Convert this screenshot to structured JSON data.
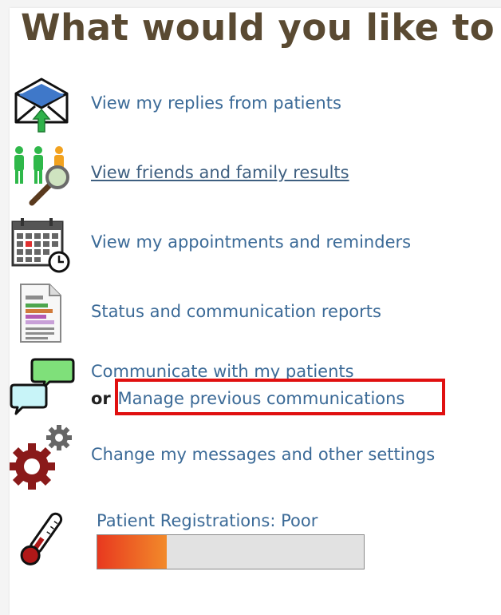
{
  "page": {
    "title": "What would you like to"
  },
  "menu": {
    "items": [
      {
        "label": "View my replies from patients",
        "icon": "envelope-reply-icon"
      },
      {
        "label": "View friends and family results",
        "icon": "people-magnifier-icon"
      },
      {
        "label": "View my appointments and reminders",
        "icon": "calendar-clock-icon"
      },
      {
        "label": "Status and communication reports",
        "icon": "report-document-icon"
      },
      {
        "label": "Communicate with my patients",
        "icon": "speech-bubbles-icon"
      },
      {
        "label": "Change my messages and other settings",
        "icon": "gears-icon"
      }
    ],
    "or_word": "or",
    "manage_label": "Manage previous communications"
  },
  "registrations": {
    "label": "Patient Registrations: Poor",
    "level_fraction": 0.26,
    "icon": "thermometer-icon"
  },
  "colors": {
    "title": "#5a4a32",
    "link": "#3b6a97",
    "highlight": "#e01010",
    "progress_start": "#e8391f",
    "progress_end": "#f28a2a"
  }
}
